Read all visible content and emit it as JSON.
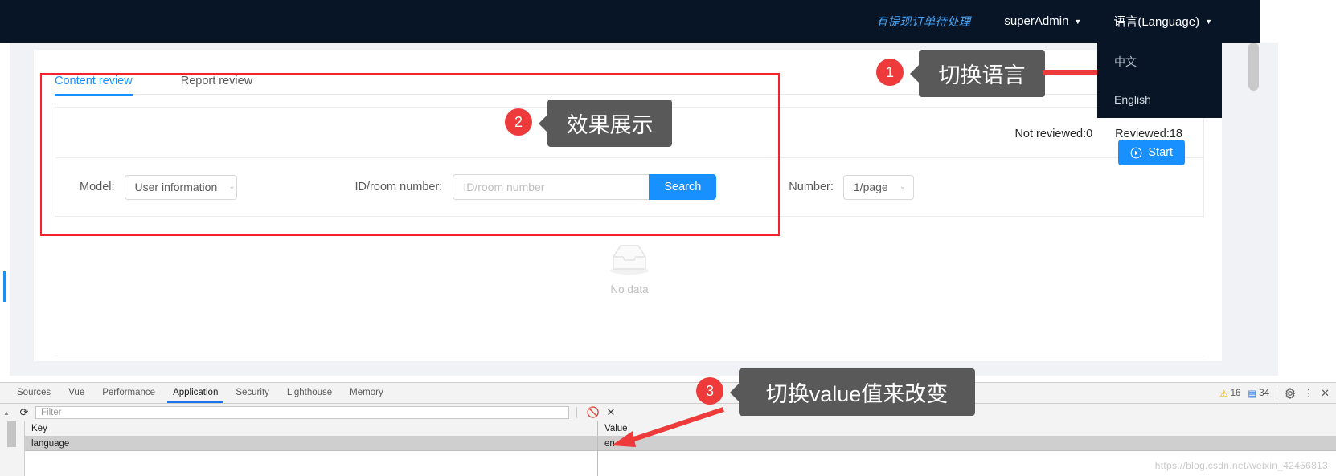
{
  "topnav": {
    "withdraw_notice": "有提现订单待处理",
    "user": "superAdmin",
    "language_label": "语言(Language)",
    "caret": "▼"
  },
  "language_menu": {
    "items": [
      {
        "label": "中文"
      },
      {
        "label": "English"
      }
    ]
  },
  "tabs": [
    {
      "label": "Content review",
      "active": true
    },
    {
      "label": "Report review",
      "active": false
    }
  ],
  "panel": {
    "not_reviewed": "Not reviewed:0",
    "reviewed": "Reviewed:18",
    "model_label": "Model:",
    "model_value": "User information",
    "id_label": "ID/room number:",
    "id_placeholder": "ID/room number",
    "search_button": "Search",
    "number_label": "Number:",
    "number_value": "1/page",
    "start_button": "Start",
    "select_caret": "⌄"
  },
  "empty_state": {
    "label": "No data"
  },
  "callouts": [
    {
      "num": "1",
      "text": "切换语言"
    },
    {
      "num": "2",
      "text": "效果展示"
    },
    {
      "num": "3",
      "text": "切换value值来改变"
    }
  ],
  "devtools": {
    "tabs": [
      {
        "label": "Sources",
        "active": false
      },
      {
        "label": "Vue",
        "active": false
      },
      {
        "label": "Performance",
        "active": false
      },
      {
        "label": "Application",
        "active": true
      },
      {
        "label": "Security",
        "active": false
      },
      {
        "label": "Lighthouse",
        "active": false
      },
      {
        "label": "Memory",
        "active": false
      }
    ],
    "status": {
      "warn_icon": "⚠",
      "warn_count": "16",
      "msg_icon": "▤",
      "msg_count": "34"
    },
    "toolbar": {
      "filter_placeholder": "Filter"
    },
    "table": {
      "headers": [
        "Key",
        "Value"
      ],
      "rows": [
        {
          "key": "language",
          "value": "en"
        }
      ]
    }
  },
  "watermark": "https://blog.csdn.net/weixin_42456813",
  "colors": {
    "nav_bg": "#071527",
    "accent": "#1890ff",
    "highlight": "#f5222d",
    "callout_bg": "#595959",
    "badge_bg": "#ee3a3a"
  }
}
